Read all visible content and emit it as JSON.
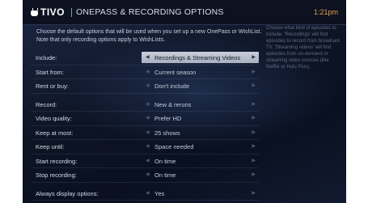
{
  "header": {
    "logo": "TIVO",
    "title": "ONEPASS & RECORDING OPTIONS",
    "clock": "1:21pm"
  },
  "intro": "Choose the default options that will be used when you set up a new OnePass or WishList. Note that only recording options apply to WishLists.",
  "help": "Choose what kind of episodes to include. 'Recordings' will find episodes to record from broadcast TV. 'Streaming videos' will find episodes from on-demand or streaming video sources (like Netflix or Hulu Plus).",
  "options": [
    {
      "label": "Include:",
      "value": "Recordings & Streaming Videos"
    },
    {
      "label": "Start from:",
      "value": "Current season"
    },
    {
      "label": "Rent or buy:",
      "value": "Don't include"
    },
    {
      "label": "Record:",
      "value": "New & reruns"
    },
    {
      "label": "Video quality:",
      "value": "Prefer HD"
    },
    {
      "label": "Keep at most:",
      "value": "25 shows"
    },
    {
      "label": "Keep until:",
      "value": "Space needed"
    },
    {
      "label": "Start recording:",
      "value": "On time"
    },
    {
      "label": "Stop recording:",
      "value": "On time"
    },
    {
      "label": "Always display options:",
      "value": "Yes"
    }
  ],
  "selected_index": 0,
  "icons": {
    "left_arrow": "left-arrow-icon",
    "right_arrow": "right-arrow-icon",
    "logo_icon": "tivo-tv-icon"
  },
  "colors": {
    "clock": "#e8a04a",
    "highlight": "#c9cfda",
    "background": "#0d1424"
  }
}
